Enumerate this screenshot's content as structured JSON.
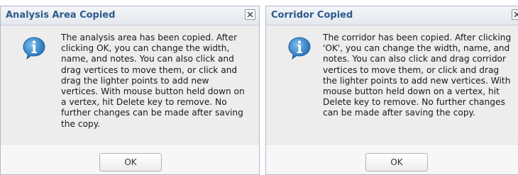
{
  "dialogs": [
    {
      "title": "Analysis Area Copied",
      "message": "The analysis area has been copied. After clicking OK, you can change the width, name, and notes. You can also click and drag vertices to move them, or click and drag the lighter points to add new vertices. With mouse button held down on a vertex, hit Delete key to remove. No further changes can be made after saving the copy.",
      "ok_label": "OK",
      "close_icon": "close-icon",
      "info_icon": "info-icon"
    },
    {
      "title": "Corridor Copied",
      "message": "The corridor has been copied. After clicking 'OK', you can change the width, name, and notes. You can also click and drag corridor vertices to move them, or click and drag the lighter points to add new vertices. With mouse button held down on a vertex, hit Delete key to remove. No further changes can be made after saving the copy.",
      "ok_label": "OK",
      "close_icon": "close-icon",
      "info_icon": "info-icon"
    }
  ],
  "colors": {
    "title_text": "#2b5a8c",
    "dialog_bg": "#ededed",
    "info_icon_blue": "#2f7fc8"
  }
}
